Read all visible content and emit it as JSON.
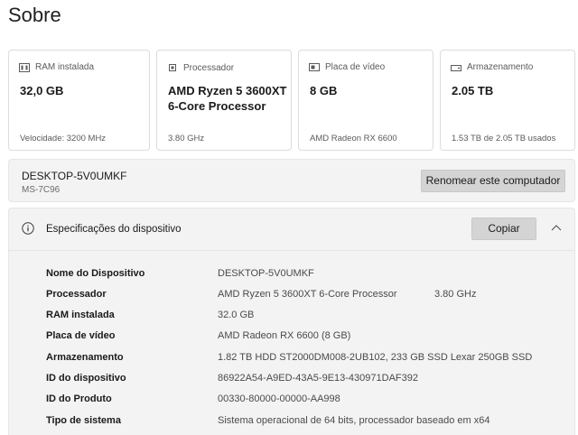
{
  "page": {
    "title": "Sobre"
  },
  "cards": [
    {
      "label": "RAM instalada",
      "value": "32,0 GB",
      "sub": "Velocidade: 3200 MHz",
      "icon": "ram-icon"
    },
    {
      "label": "Processador",
      "value_line1": "AMD Ryzen 5 3600XT",
      "value_line2": "6-Core Processor",
      "sub": "3.80 GHz",
      "icon": "processor-icon"
    },
    {
      "label": "Placa de vídeo",
      "value": "8 GB",
      "sub": "AMD Radeon RX 6600",
      "icon": "gpu-icon"
    },
    {
      "label": "Armazenamento",
      "value": "2.05 TB",
      "sub": "1.53 TB de 2.05 TB usados",
      "icon": "storage-icon"
    }
  ],
  "device": {
    "name": "DESKTOP-5V0UMKF",
    "model": "MS-7C96",
    "rename_label": "Renomear este computador"
  },
  "specs": {
    "title": "Especificações do dispositivo",
    "copy_label": "Copiar",
    "rows": [
      {
        "key": "Nome do Dispositivo",
        "value": "DESKTOP-5V0UMKF"
      },
      {
        "key": "Processador",
        "value": "AMD Ryzen 5 3600XT 6-Core Processor",
        "extra": "3.80 GHz"
      },
      {
        "key": "RAM instalada",
        "value": "32.0 GB"
      },
      {
        "key": "Placa de vídeo",
        "value": "AMD Radeon RX 6600 (8 GB)"
      },
      {
        "key": "Armazenamento",
        "value": "1.82 TB HDD ST2000DM008-2UB102, 233 GB SSD Lexar 250GB SSD"
      },
      {
        "key": "ID do dispositivo",
        "value": "86922A54-A9ED-43A5-9E13-430971DAF392"
      },
      {
        "key": "ID do Produto",
        "value": "00330-80000-00000-AA998"
      },
      {
        "key": "Tipo de sistema",
        "value": "Sistema operacional de 64 bits, processador baseado em x64"
      }
    ]
  }
}
